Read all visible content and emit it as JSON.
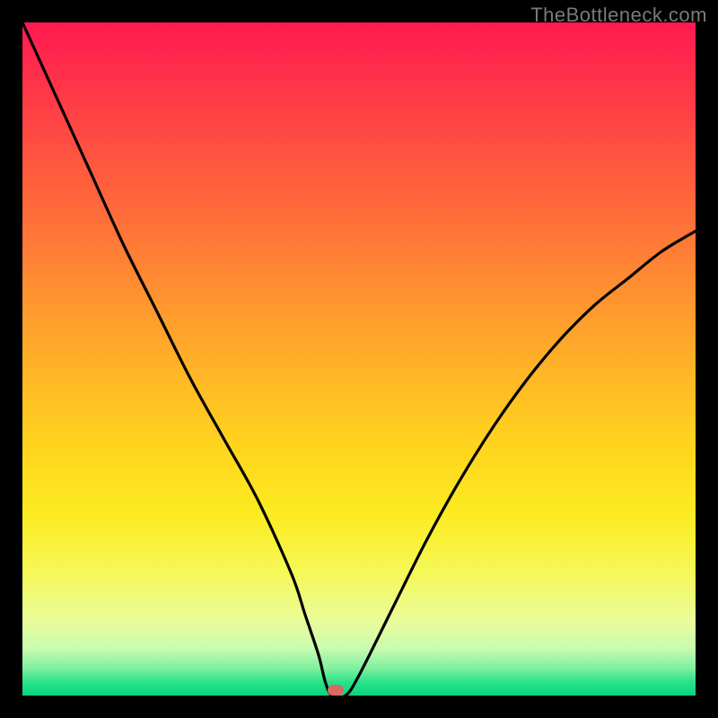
{
  "source_watermark": "TheBottleneck.com",
  "chart_data": {
    "type": "line",
    "title": "",
    "xlabel": "",
    "ylabel": "",
    "xlim": [
      0,
      100
    ],
    "ylim": [
      0,
      100
    ],
    "grid": false,
    "legend": false,
    "series": [
      {
        "name": "curve",
        "color": "#000000",
        "x": [
          0,
          5,
          10,
          15,
          20,
          25,
          30,
          35,
          40,
          42,
          44,
          45,
          46,
          48,
          50,
          55,
          60,
          65,
          70,
          75,
          80,
          85,
          90,
          95,
          100
        ],
        "y": [
          100,
          89,
          78,
          67,
          57,
          47,
          38,
          29,
          18,
          12,
          6,
          2,
          0,
          0,
          3,
          13,
          23,
          32,
          40,
          47,
          53,
          58,
          62,
          66,
          69
        ]
      }
    ],
    "marker": {
      "x": 46.5,
      "y": 0.8,
      "color": "#d86a60"
    },
    "background_gradient": {
      "orientation": "vertical",
      "stops": [
        {
          "pos": 0.0,
          "color": "#ff1a52"
        },
        {
          "pos": 0.33,
          "color": "#ff7a36"
        },
        {
          "pos": 0.63,
          "color": "#ffd41e"
        },
        {
          "pos": 0.89,
          "color": "#eafc9a"
        },
        {
          "pos": 1.0,
          "color": "#09d47e"
        }
      ]
    }
  }
}
